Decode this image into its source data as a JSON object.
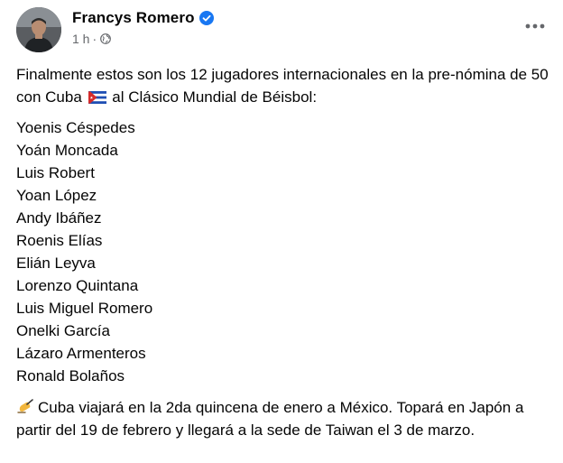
{
  "author": {
    "name": "Francys Romero",
    "verified_icon": "verified-badge-icon",
    "time": "1 h",
    "separator": "·",
    "audience_icon": "globe-icon"
  },
  "post": {
    "intro_before_flag": "Finalmente estos son los 12 jugadores internacionales en la pre-nómina de 50 con Cuba",
    "flag_icon": "cuba-flag-icon",
    "intro_after_flag": "al Clásico Mundial de Béisbol:",
    "players": [
      "Yoenis Céspedes",
      "Yoán Moncada",
      "Luis Robert",
      "Yoan López",
      "Andy Ibáñez",
      "Roenis Elías",
      "Elián Leyva",
      "Lorenzo Quintana",
      "Luis Miguel Romero",
      "Onelki García",
      "Lázaro Armenteros",
      "Ronald Bolaños"
    ],
    "closing_icon": "writing-hand-icon",
    "closing": "Cuba viajará en la 2da quincena de enero a México. Topará en Japón a partir del 19 de febrero y llegará a la sede de Taiwan el 3 de marzo."
  },
  "colors": {
    "text": "#050505",
    "secondary_text": "#65676b",
    "verified_blue": "#1877f2"
  }
}
